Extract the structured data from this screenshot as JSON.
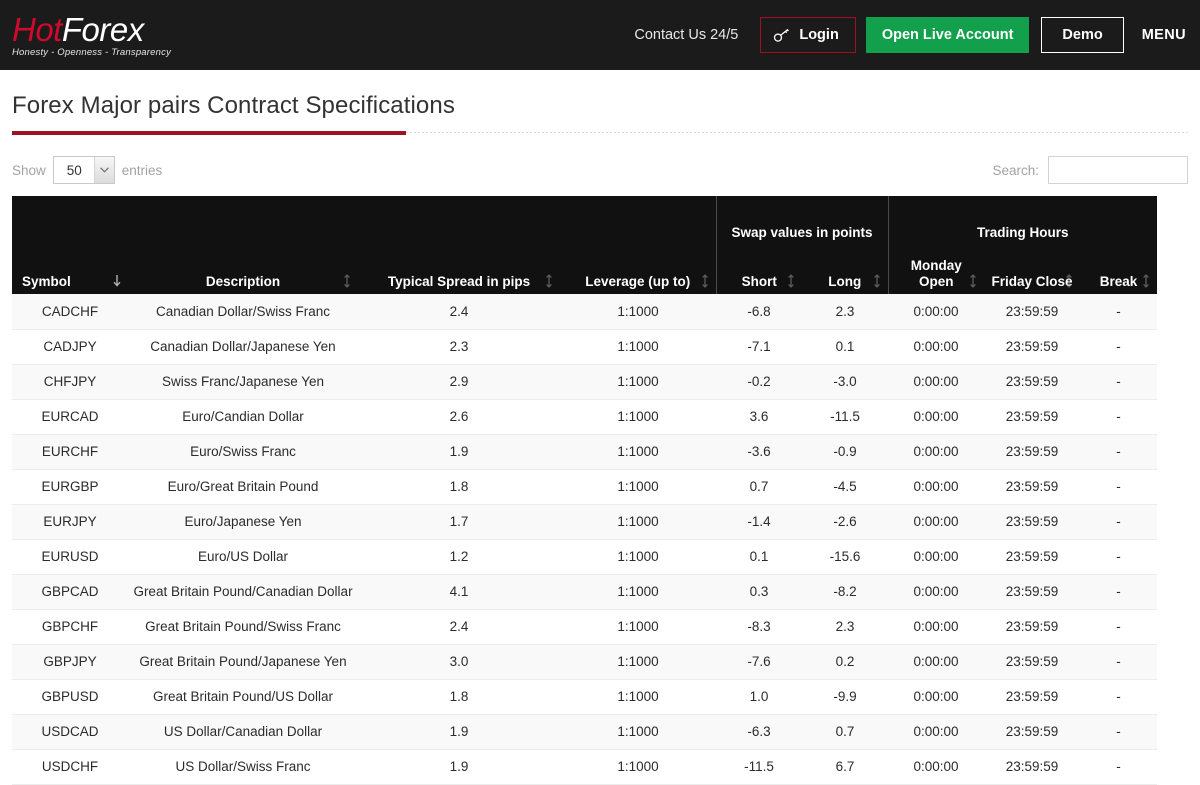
{
  "header": {
    "logo": {
      "part1": "Hot",
      "part2": "Forex",
      "tagline": "Honesty - Openness - Transparency"
    },
    "contact": "Contact Us 24/5",
    "login_label": "Login",
    "login_icon": "key-icon",
    "live_account_label": "Open Live Account",
    "demo_label": "Demo",
    "menu_label": "MENU",
    "colors": {
      "brand_red": "#cf0a2c",
      "green": "#13a04c",
      "bar": "#1b1b1b"
    }
  },
  "page": {
    "title": "Forex Major pairs Contract Specifications",
    "rule_color": "#9c1421"
  },
  "controls": {
    "show_label": "Show",
    "entries_label": "entries",
    "page_length": "50",
    "search_label": "Search:",
    "search_value": "",
    "search_placeholder": ""
  },
  "table": {
    "groups": [
      {
        "label": "",
        "span": 4
      },
      {
        "label": "Swap values in points",
        "span": 2
      },
      {
        "label": "Trading Hours",
        "span": 3
      }
    ],
    "columns": [
      {
        "key": "symbol",
        "label": "Symbol",
        "sort": "desc-active"
      },
      {
        "key": "description",
        "label": "Description",
        "sort": "both"
      },
      {
        "key": "spread",
        "label": "Typical Spread in pips",
        "sort": "both"
      },
      {
        "key": "leverage",
        "label": "Leverage (up to)",
        "sort": "both"
      },
      {
        "key": "short",
        "label": "Short",
        "sort": "both"
      },
      {
        "key": "long",
        "label": "Long",
        "sort": "both"
      },
      {
        "key": "monday_open",
        "label": "Monday Open",
        "sort": "both"
      },
      {
        "key": "friday_close",
        "label": "Friday Close",
        "sort": "both"
      },
      {
        "key": "break",
        "label": "Break",
        "sort": "both"
      }
    ],
    "rows": [
      [
        "CADCHF",
        "Canadian Dollar/Swiss Franc",
        "2.4",
        "1:1000",
        "-6.8",
        "2.3",
        "0:00:00",
        "23:59:59",
        "-"
      ],
      [
        "CADJPY",
        "Canadian Dollar/Japanese Yen",
        "2.3",
        "1:1000",
        "-7.1",
        "0.1",
        "0:00:00",
        "23:59:59",
        "-"
      ],
      [
        "CHFJPY",
        "Swiss Franc/Japanese Yen",
        "2.9",
        "1:1000",
        "-0.2",
        "-3.0",
        "0:00:00",
        "23:59:59",
        "-"
      ],
      [
        "EURCAD",
        "Euro/Candian Dollar",
        "2.6",
        "1:1000",
        "3.6",
        "-11.5",
        "0:00:00",
        "23:59:59",
        "-"
      ],
      [
        "EURCHF",
        "Euro/Swiss Franc",
        "1.9",
        "1:1000",
        "-3.6",
        "-0.9",
        "0:00:00",
        "23:59:59",
        "-"
      ],
      [
        "EURGBP",
        "Euro/Great Britain Pound",
        "1.8",
        "1:1000",
        "0.7",
        "-4.5",
        "0:00:00",
        "23:59:59",
        "-"
      ],
      [
        "EURJPY",
        "Euro/Japanese Yen",
        "1.7",
        "1:1000",
        "-1.4",
        "-2.6",
        "0:00:00",
        "23:59:59",
        "-"
      ],
      [
        "EURUSD",
        "Euro/US Dollar",
        "1.2",
        "1:1000",
        "0.1",
        "-15.6",
        "0:00:00",
        "23:59:59",
        "-"
      ],
      [
        "GBPCAD",
        "Great Britain Pound/Canadian Dollar",
        "4.1",
        "1:1000",
        "0.3",
        "-8.2",
        "0:00:00",
        "23:59:59",
        "-"
      ],
      [
        "GBPCHF",
        "Great Britain Pound/Swiss Franc",
        "2.4",
        "1:1000",
        "-8.3",
        "2.3",
        "0:00:00",
        "23:59:59",
        "-"
      ],
      [
        "GBPJPY",
        "Great Britain Pound/Japanese Yen",
        "3.0",
        "1:1000",
        "-7.6",
        "0.2",
        "0:00:00",
        "23:59:59",
        "-"
      ],
      [
        "GBPUSD",
        "Great Britain Pound/US Dollar",
        "1.8",
        "1:1000",
        "1.0",
        "-9.9",
        "0:00:00",
        "23:59:59",
        "-"
      ],
      [
        "USDCAD",
        "US Dollar/Canadian Dollar",
        "1.9",
        "1:1000",
        "-6.3",
        "0.7",
        "0:00:00",
        "23:59:59",
        "-"
      ],
      [
        "USDCHF",
        "US Dollar/Swiss Franc",
        "1.9",
        "1:1000",
        "-11.5",
        "6.7",
        "0:00:00",
        "23:59:59",
        "-"
      ]
    ]
  }
}
